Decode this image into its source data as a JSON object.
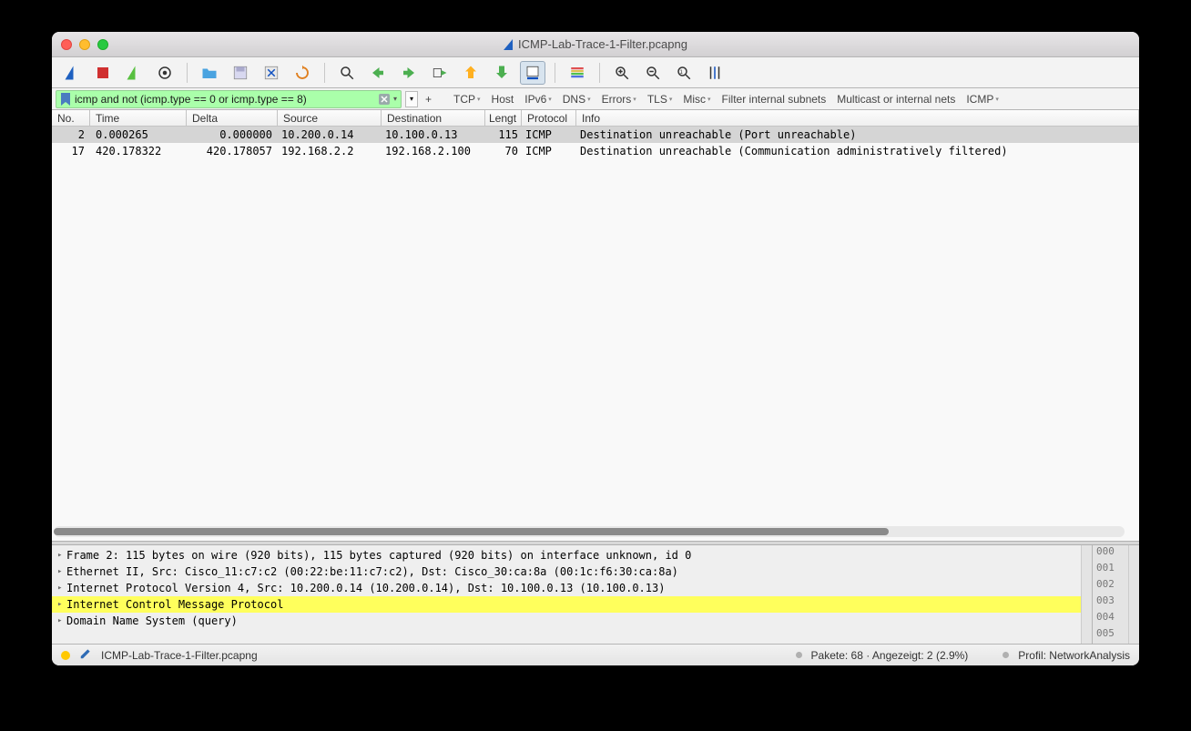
{
  "window": {
    "title": "ICMP-Lab-Trace-1-Filter.pcapng"
  },
  "filter": {
    "text": "icmp and not (icmp.type == 0 or icmp.type == 8)"
  },
  "filter_buttons": {
    "plus": "+",
    "tcp": "TCP",
    "host": "Host",
    "ipv6": "IPv6",
    "dns": "DNS",
    "errors": "Errors",
    "tls": "TLS",
    "misc": "Misc",
    "fis": "Filter internal subnets",
    "mis": "Multicast or internal nets",
    "icmp": "ICMP"
  },
  "columns": {
    "no": "No.",
    "time": "Time",
    "delta": "Delta",
    "source": "Source",
    "destination": "Destination",
    "length": "Lengt",
    "protocol": "Protocol",
    "info": "Info"
  },
  "packets": [
    {
      "no": "2",
      "time": "0.000265",
      "delta": "0.000000",
      "source": "10.200.0.14",
      "dest": "10.100.0.13",
      "len": "115",
      "proto": "ICMP",
      "info": "Destination unreachable (Port unreachable)"
    },
    {
      "no": "17",
      "time": "420.178322",
      "delta": "420.178057",
      "source": "192.168.2.2",
      "dest": "192.168.2.100",
      "len": "70",
      "proto": "ICMP",
      "info": "Destination unreachable (Communication administratively filtered)"
    }
  ],
  "details": {
    "frame": "Frame 2: 115 bytes on wire (920 bits), 115 bytes captured (920 bits) on interface unknown, id 0",
    "eth": "Ethernet II, Src: Cisco_11:c7:c2 (00:22:be:11:c7:c2), Dst: Cisco_30:ca:8a (00:1c:f6:30:ca:8a)",
    "ip": "Internet Protocol Version 4, Src: 10.200.0.14 (10.200.0.14), Dst: 10.100.0.13 (10.100.0.13)",
    "icmp": "Internet Control Message Protocol",
    "dns": "Domain Name System (query)"
  },
  "hex_offsets": [
    "000",
    "001",
    "002",
    "003",
    "004",
    "005"
  ],
  "status": {
    "file": "ICMP-Lab-Trace-1-Filter.pcapng",
    "packets": "Pakete: 68 · Angezeigt: 2 (2.9%)",
    "profile": "Profil: NetworkAnalysis"
  }
}
